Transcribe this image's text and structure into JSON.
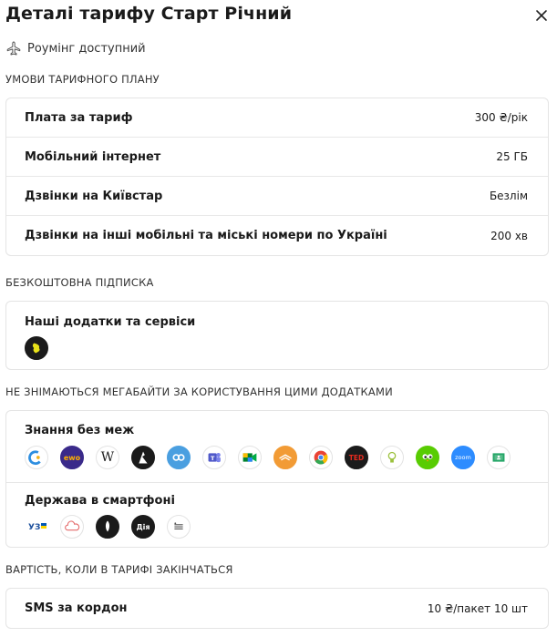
{
  "header": {
    "title": "Деталі тарифу Старт Річний",
    "roaming": "Роумінг доступний",
    "close_icon": "close-icon",
    "roaming_icon": "airplane-icon"
  },
  "sections": {
    "conditions": {
      "label": "УМОВИ ТАРИФНОГО ПЛАНУ",
      "rows": [
        {
          "label": "Плата за тариф",
          "value": "300 ₴/рік"
        },
        {
          "label": "Мобільний інтернет",
          "value": "25 ГБ"
        },
        {
          "label": "Дзвінки на Київстар",
          "value": "Безлім"
        },
        {
          "label": "Дзвінки на інші мобільні та міські номери по Україні",
          "value": "200 хв"
        }
      ]
    },
    "subscription": {
      "label": "БЕЗКОШТОВНА ПІДПИСКА",
      "title": "Наші додатки та сервіси",
      "icons": [
        "app-service-icon"
      ]
    },
    "zero_rated": {
      "label": "НЕ ЗНІМАЮТЬСЯ МЕГАБАЙТИ ЗА КОРИСТУВАННЯ ЦИМИ ДОДАТКАМИ",
      "groups": [
        {
          "title": "Знання без меж",
          "icons": [
            "edu-app-icon",
            "ewo-app-icon",
            "wikipedia-icon",
            "ukrainian-lessons-icon",
            "coursera-icon",
            "teams-icon",
            "google-meet-icon",
            "audible-icon",
            "chrome-icon",
            "ted-icon",
            "idea-app-icon",
            "duolingo-icon",
            "zoom-icon",
            "google-classroom-icon"
          ]
        },
        {
          "title": "Держава в смартфоні",
          "icons": [
            "uz-railway-icon",
            "cloud-service-icon",
            "trident-icon",
            "diia-icon",
            "gov-service-icon"
          ]
        }
      ]
    },
    "after_limits": {
      "label": "ВАРТІСТЬ, КОЛИ В ТАРИФІ ЗАКІНЧАТЬСЯ",
      "rows": [
        {
          "label": "SMS за кордон",
          "value": "10 ₴/пакет 10 шт"
        }
      ]
    }
  },
  "colors": {
    "text": "#1a1a1a",
    "border": "#e4e4e4",
    "background": "#ffffff"
  }
}
